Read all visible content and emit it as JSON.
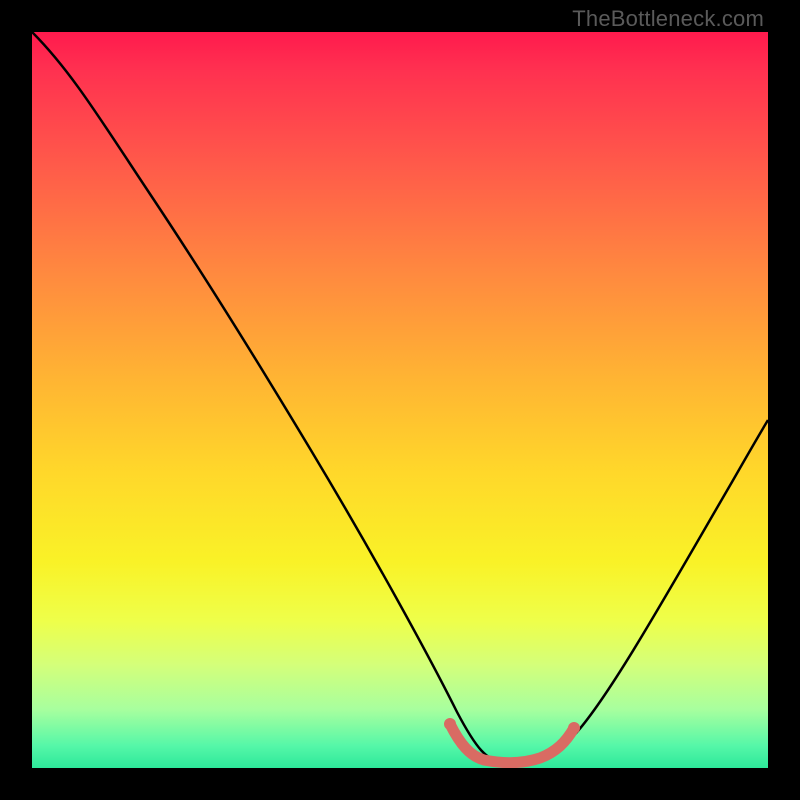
{
  "watermark": "TheBottleneck.com",
  "chart_data": {
    "type": "line",
    "title": "",
    "xlabel": "",
    "ylabel": "",
    "xlim": [
      0,
      100
    ],
    "ylim": [
      0,
      100
    ],
    "series": [
      {
        "name": "bottleneck-curve",
        "x": [
          0,
          8,
          16,
          24,
          32,
          40,
          48,
          55,
          58,
          62,
          66,
          70,
          74,
          80,
          88,
          96,
          100
        ],
        "values": [
          100,
          90,
          78,
          66,
          54,
          42,
          30,
          14,
          6,
          2,
          1,
          2,
          6,
          14,
          28,
          42,
          50
        ]
      },
      {
        "name": "optimal-range-marker",
        "x": [
          58,
          60,
          62,
          64,
          66,
          68,
          70
        ],
        "values": [
          4,
          2,
          1,
          1,
          1,
          2,
          4
        ]
      }
    ],
    "annotations": []
  },
  "colors": {
    "curve": "#000000",
    "marker": "#d96b63",
    "background_top": "#ff1a4d",
    "background_bottom": "#2de89a"
  }
}
